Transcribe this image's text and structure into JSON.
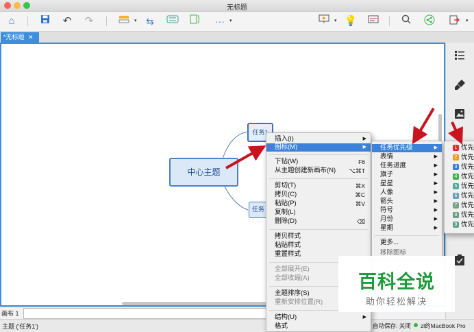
{
  "window": {
    "title": "无标题"
  },
  "tab": {
    "label": "*无标题",
    "close": "✕"
  },
  "nodes": {
    "central": "中心主题",
    "task1": "任务1",
    "task_lower": "任务"
  },
  "menu": {
    "insert": "插入(I)",
    "icon": "图标(M)",
    "drill_down": "下钻(W)",
    "drill_down_sc": "F6",
    "new_sheet": "从主题创建新画布(N)",
    "new_sheet_sc": "⌥⌘T",
    "cut": "剪切(T)",
    "cut_sc": "⌘X",
    "copy": "拷贝(C)",
    "copy_sc": "⌘C",
    "paste": "粘贴(P)",
    "paste_sc": "⌘V",
    "duplicate": "复制(L)",
    "delete": "删除(D)",
    "delete_sc": "⌫",
    "copy_style": "拷贝样式",
    "paste_style": "粘贴样式",
    "reset_style": "重置样式",
    "expand_all": "全部展开(E)",
    "collapse_all": "全部收缩(A)",
    "sort": "主题排序(S)",
    "rearrange": "重新安排位置(R)",
    "structure": "结构(U)",
    "format": "格式"
  },
  "submenu": {
    "items": [
      "任务优先级",
      "表情",
      "任务进度",
      "旗子",
      "星星",
      "人像",
      "箭头",
      "符号",
      "月份",
      "星期"
    ],
    "more": "更多...",
    "partial": "移除图标"
  },
  "priority": {
    "items": [
      {
        "n": "1",
        "label": "优先",
        "color": "#e8262c"
      },
      {
        "n": "2",
        "label": "优先",
        "color": "#f39a1e"
      },
      {
        "n": "3",
        "label": "优先",
        "color": "#3a7fd5"
      },
      {
        "n": "4",
        "label": "优先",
        "color": "#3bb34a"
      },
      {
        "n": "5",
        "label": "优先",
        "color": "#53a8a0"
      },
      {
        "n": "6",
        "label": "优先",
        "color": "#6a9fb8"
      },
      {
        "n": "7",
        "label": "优先",
        "color": "#7aa08a"
      },
      {
        "n": "8",
        "label": "优先",
        "color": "#6f9c86"
      },
      {
        "n": "9",
        "label": "优先",
        "color": "#62a08e"
      }
    ]
  },
  "sheet": {
    "label": "画布 1"
  },
  "status": {
    "topic": "主题 ('任务1')",
    "autosave": "自动保存: 关闭",
    "device": "zl的MacBook Pro"
  },
  "watermark": {
    "title": "百科全说",
    "subtitle": "助你轻松解决"
  },
  "colors": {
    "accent": "#3d8fdc",
    "arrow": "#c8141e",
    "highlight": "#3b82d8",
    "watermark_green": "#1e9b3c"
  }
}
